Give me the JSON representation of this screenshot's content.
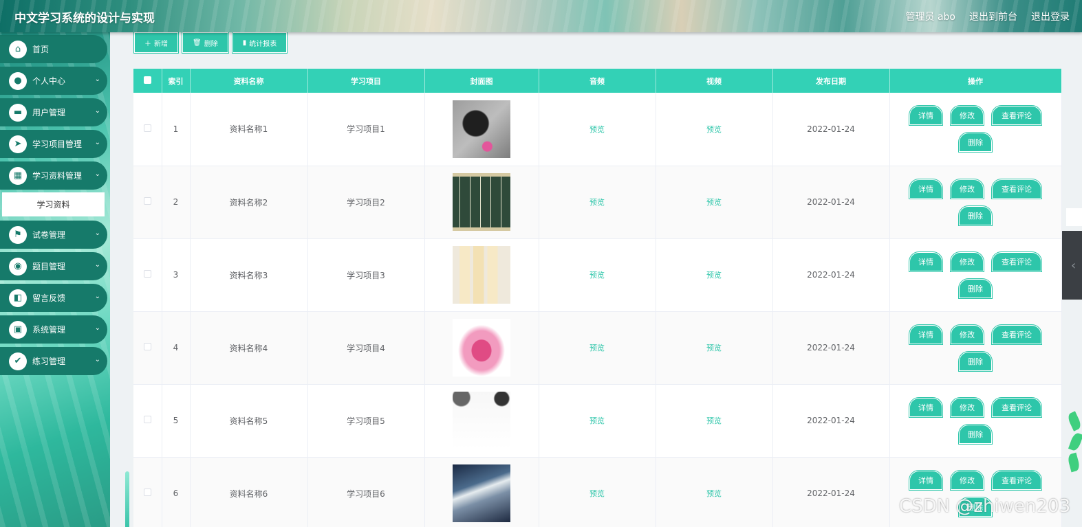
{
  "header": {
    "title": "中文学习系统的设计与实现",
    "admin_label": "管理员 abo",
    "front_link": "退出到前台",
    "logout_link": "退出登录"
  },
  "sidebar": {
    "items": [
      {
        "label": "首页",
        "icon": "home-icon",
        "glyph": "⌂",
        "chevron": false
      },
      {
        "label": "个人中心",
        "icon": "user-icon",
        "glyph": "●",
        "chevron": true
      },
      {
        "label": "用户管理",
        "icon": "briefcase-icon",
        "glyph": "▬",
        "chevron": true
      },
      {
        "label": "学习项目管理",
        "icon": "paper-plane-icon",
        "glyph": "➤",
        "chevron": true
      },
      {
        "label": "学习资料管理",
        "icon": "grid-icon",
        "glyph": "▦",
        "chevron": true
      },
      {
        "label": "试卷管理",
        "icon": "flag-icon",
        "glyph": "⚑",
        "chevron": true
      },
      {
        "label": "题目管理",
        "icon": "location-icon",
        "glyph": "◉",
        "chevron": true
      },
      {
        "label": "留言反馈",
        "icon": "wallet-icon",
        "glyph": "◧",
        "chevron": true
      },
      {
        "label": "系统管理",
        "icon": "apps-icon",
        "glyph": "▣",
        "chevron": true
      },
      {
        "label": "练习管理",
        "icon": "clipboard-icon",
        "glyph": "✔",
        "chevron": true
      }
    ],
    "submenu_active": "学习资料"
  },
  "toolbar": {
    "add_label": "新增",
    "delete_label": "删除",
    "report_label": "统计报表"
  },
  "table": {
    "columns": [
      "",
      "索引",
      "资料名称",
      "学习项目",
      "封面图",
      "音频",
      "视频",
      "发布日期",
      "操作"
    ],
    "rows": [
      {
        "index": "1",
        "name": "资料名称1",
        "project": "学习项目1",
        "audio": "预览",
        "video": "预览",
        "date": "2022-01-24"
      },
      {
        "index": "2",
        "name": "资料名称2",
        "project": "学习项目2",
        "audio": "预览",
        "video": "预览",
        "date": "2022-01-24"
      },
      {
        "index": "3",
        "name": "资料名称3",
        "project": "学习项目3",
        "audio": "预览",
        "video": "预览",
        "date": "2022-01-24"
      },
      {
        "index": "4",
        "name": "资料名称4",
        "project": "学习项目4",
        "audio": "预览",
        "video": "预览",
        "date": "2022-01-24"
      },
      {
        "index": "5",
        "name": "资料名称5",
        "project": "学习项目5",
        "audio": "预览",
        "video": "预览",
        "date": "2022-01-24"
      },
      {
        "index": "6",
        "name": "资料名称6",
        "project": "学习项目6",
        "audio": "预览",
        "video": "预览",
        "date": "2022-01-24"
      }
    ],
    "actions": {
      "detail": "详情",
      "edit": "修改",
      "comments": "查看评论",
      "delete": "删除"
    }
  },
  "watermark": "CSDN @zhiwen203",
  "colors": {
    "accent": "#2ec6aa",
    "table_header": "#33d1b6",
    "sidebar_item": "#167a6a"
  }
}
